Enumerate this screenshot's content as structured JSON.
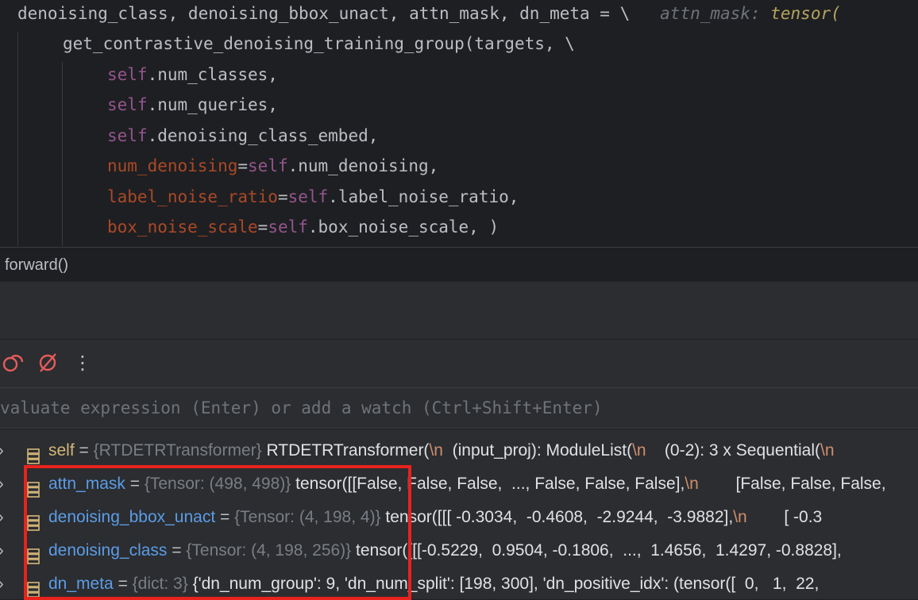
{
  "editor": {
    "lines": [
      {
        "tokens": [
          {
            "t": "denoising_class, denoising_bbox_unact, attn_mask, dn_meta = \\",
            "c": ""
          },
          {
            "t": "   attn_mask: ",
            "c": "hint"
          },
          {
            "t": "tensor(",
            "c": "hint-val"
          }
        ]
      },
      {
        "tokens": [
          {
            "t": "get_contrastive_denoising_training_group(targets, \\",
            "c": ""
          }
        ]
      },
      {
        "tokens": [
          {
            "t": "self",
            "c": "self"
          },
          {
            "t": ".num_classes,",
            "c": ""
          }
        ]
      },
      {
        "tokens": [
          {
            "t": "self",
            "c": "self"
          },
          {
            "t": ".num_queries,",
            "c": ""
          }
        ]
      },
      {
        "tokens": [
          {
            "t": "self",
            "c": "self"
          },
          {
            "t": ".denoising_class_embed,",
            "c": ""
          }
        ]
      },
      {
        "tokens": [
          {
            "t": "num_denoising",
            "c": "param"
          },
          {
            "t": "=",
            "c": ""
          },
          {
            "t": "self",
            "c": "self"
          },
          {
            "t": ".num_denoising,",
            "c": ""
          }
        ]
      },
      {
        "tokens": [
          {
            "t": "label_noise_ratio",
            "c": "param"
          },
          {
            "t": "=",
            "c": ""
          },
          {
            "t": "self",
            "c": "self"
          },
          {
            "t": ".label_noise_ratio,",
            "c": ""
          }
        ]
      },
      {
        "tokens": [
          {
            "t": "box_noise_scale",
            "c": "param"
          },
          {
            "t": "=",
            "c": ""
          },
          {
            "t": "self",
            "c": "self"
          },
          {
            "t": ".box_noise_scale, )",
            "c": ""
          }
        ]
      }
    ]
  },
  "breadcrumb": {
    "label": "forward()"
  },
  "toolbar": {
    "icons": [
      "mute-breakpoints-icon",
      "disable-breakpoints-icon",
      "more-options-icon"
    ],
    "more_glyph": "⋮"
  },
  "evaluate": {
    "placeholder": "valuate expression (Enter) or add a watch (Ctrl+Shift+Enter)"
  },
  "variables": [
    {
      "chevron": "›",
      "name": "self",
      "type": "{RTDETRTransformer}",
      "value": [
        {
          "t": " RTDETRTransformer(",
          "c": "vval"
        },
        {
          "t": "\\n",
          "c": "vnl"
        },
        {
          "t": "  (input_proj): ModuleList(",
          "c": "vval"
        },
        {
          "t": "\\n",
          "c": "vnl"
        },
        {
          "t": "    (0-2): 3 x Sequential(",
          "c": "vval"
        },
        {
          "t": "\\n",
          "c": "vnl"
        }
      ]
    },
    {
      "chevron": "›",
      "name": "attn_mask",
      "type": "{Tensor: (498, 498)}",
      "value": [
        {
          "t": " tensor([[False, False, False,  ..., False, False, False],",
          "c": "vval"
        },
        {
          "t": "\\n",
          "c": "vnl"
        },
        {
          "t": "        [False, False, False,",
          "c": "vval"
        }
      ]
    },
    {
      "chevron": "›",
      "name": "denoising_bbox_unact",
      "type": "{Tensor: (4, 198, 4)}",
      "value": [
        {
          "t": " tensor([[[ -0.3034,  -0.4608,  -2.9244,  -3.9882],",
          "c": "vval"
        },
        {
          "t": "\\n",
          "c": "vnl"
        },
        {
          "t": "        [ -0.3",
          "c": "vval"
        }
      ]
    },
    {
      "chevron": "›",
      "name": "denoising_class",
      "type": "{Tensor: (4, 198, 256)}",
      "value": [
        {
          "t": " tensor([[[-0.5229,  0.9504, -0.1806,  ...,  1.4656,  1.4297, -0.8828],",
          "c": "vval"
        }
      ]
    },
    {
      "chevron": "›",
      "name": "dn_meta",
      "type": "{dict: 3}",
      "value": [
        {
          "t": " {'dn_num_group': 9, 'dn_num_split': [198, 300], 'dn_positive_idx': (tensor([  0,   1,  22,",
          "c": "vval"
        }
      ]
    }
  ],
  "colors": {
    "highlight_box": "#e8221c",
    "background": "#1e1f22",
    "panel": "#2b2d30"
  }
}
